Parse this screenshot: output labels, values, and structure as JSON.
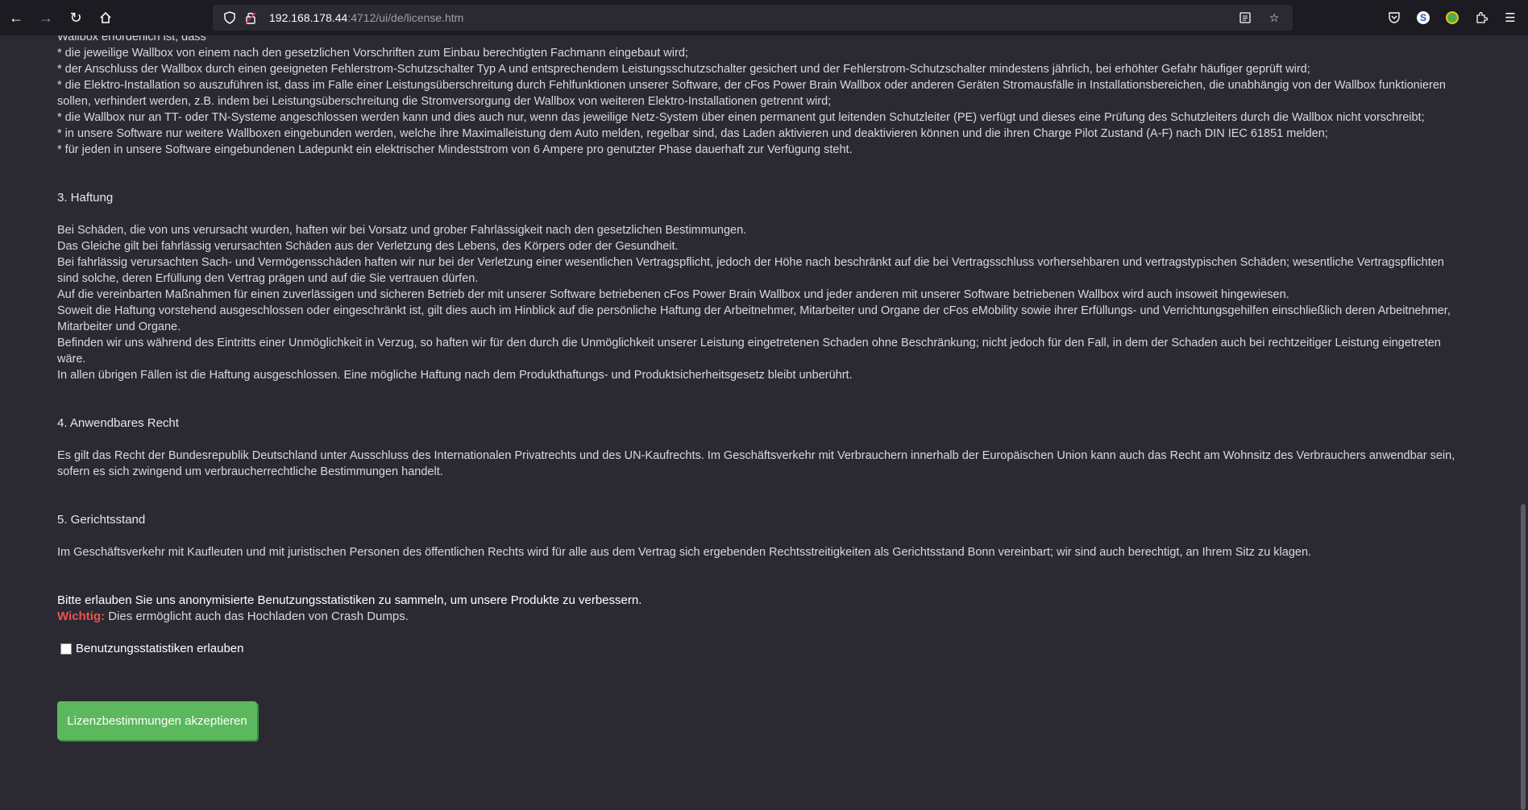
{
  "browser": {
    "url_host": "192.168.178.44",
    "url_path": ":4712/ui/de/license.htm"
  },
  "top_text": [
    "Wallbox erforderlich ist, dass",
    "* die jeweilige Wallbox von einem nach den gesetzlichen Vorschriften zum Einbau berechtigten Fachmann eingebaut wird;",
    "* der Anschluss der Wallbox durch einen geeigneten Fehlerstrom-Schutzschalter Typ A und entsprechendem Leistungsschutzschalter gesichert und der Fehlerstrom-Schutzschalter mindestens jährlich, bei erhöhter Gefahr häufiger geprüft wird;",
    "* die Elektro-Installation so auszuführen ist, dass im Falle einer Leistungsüberschreitung durch Fehlfunktionen unserer Software, der cFos Power Brain Wallbox oder anderen Geräten Stromausfälle in Installationsbereichen, die unabhängig von der Wallbox funktionieren sollen, verhindert werden, z.B. indem bei Leistungsüberschreitung die Stromversorgung der Wallbox von weiteren Elektro-Installationen getrennt wird;",
    "* die Wallbox nur an TT- oder TN-Systeme angeschlossen werden kann und dies auch nur, wenn das jeweilige Netz-System über einen permanent gut leitenden Schutzleiter (PE) verfügt und dieses eine Prüfung des Schutzleiters durch die Wallbox nicht vorschreibt;",
    "* in unsere Software nur weitere Wallboxen eingebunden werden, welche ihre Maximalleistung dem Auto melden, regelbar sind, das Laden aktivieren und deaktivieren können und die ihren Charge Pilot Zustand (A-F) nach DIN IEC 61851 melden;",
    "* für jeden in unsere Software eingebundenen Ladepunkt ein elektrischer Mindeststrom von 6 Ampere pro genutzter Phase dauerhaft zur Verfügung steht."
  ],
  "section3": {
    "heading": "3. Haftung",
    "lines": [
      "Bei Schäden, die von uns verursacht wurden, haften wir bei Vorsatz und grober Fahrlässigkeit nach den gesetzlichen Bestimmungen.",
      "Das Gleiche gilt bei fahrlässig verursachten Schäden aus der Verletzung des Lebens, des Körpers oder der Gesundheit.",
      "Bei fahrlässig verursachten Sach- und Vermögensschäden haften wir nur bei der Verletzung einer wesentlichen Vertragspflicht, jedoch der Höhe nach beschränkt auf die bei Vertragsschluss vorhersehbaren und vertragstypischen Schäden; wesentliche Vertragspflichten sind solche, deren Erfüllung den Vertrag prägen und auf die Sie vertrauen dürfen.",
      "Auf die vereinbarten Maßnahmen für einen zuverlässigen und sicheren Betrieb der mit unserer Software betriebenen cFos Power Brain Wallbox und jeder anderen mit unserer Software betriebenen Wallbox wird auch insoweit hingewiesen.",
      "Soweit die Haftung vorstehend ausgeschlossen oder eingeschränkt ist, gilt dies auch im Hinblick auf die persönliche Haftung der Arbeitnehmer, Mitarbeiter und Organe der cFos eMobility sowie ihrer Erfüllungs- und Verrichtungsgehilfen einschließlich deren Arbeitnehmer, Mitarbeiter und Organe.",
      "Befinden wir uns während des Eintritts einer Unmöglichkeit in Verzug, so haften wir für den durch die Unmöglichkeit unserer Leistung eingetretenen Schaden ohne Beschränkung; nicht jedoch für den Fall, in dem der Schaden auch bei rechtzeitiger Leistung eingetreten wäre.",
      "In allen übrigen Fällen ist die Haftung ausgeschlossen. Eine mögliche Haftung nach dem Produkthaftungs- und Produktsicherheitsgesetz bleibt unberührt."
    ]
  },
  "section4": {
    "heading": "4. Anwendbares Recht",
    "text": "Es gilt das Recht der Bundesrepublik Deutschland unter Ausschluss des Internationalen Privatrechts und des UN-Kaufrechts. Im Geschäftsverkehr mit Verbrauchern innerhalb der Europäischen Union kann auch das Recht am Wohnsitz des Verbrauchers anwendbar sein, sofern es sich zwingend um verbraucherrechtliche Bestimmungen handelt."
  },
  "section5": {
    "heading": "5. Gerichtsstand",
    "text": "Im Geschäftsverkehr mit Kaufleuten und mit juristischen Personen des öffentlichen Rechts wird für alle aus dem Vertrag sich ergebenden Rechtsstreitigkeiten als Gerichtsstand Bonn vereinbart; wir sind auch berechtigt, an Ihrem Sitz zu klagen."
  },
  "stats": {
    "request": "Bitte erlauben Sie uns anonymisierte Benutzungsstatistiken zu sammeln, um unsere Produkte zu verbessern.",
    "wichtig_label": "Wichtig:",
    "wichtig_text": " Dies ermöglicht auch das Hochladen von Crash Dumps.",
    "checkbox_label": "Benutzungsstatistiken erlauben",
    "checkbox_checked": false
  },
  "accept_button": "Lizenzbestimmungen akzeptieren"
}
